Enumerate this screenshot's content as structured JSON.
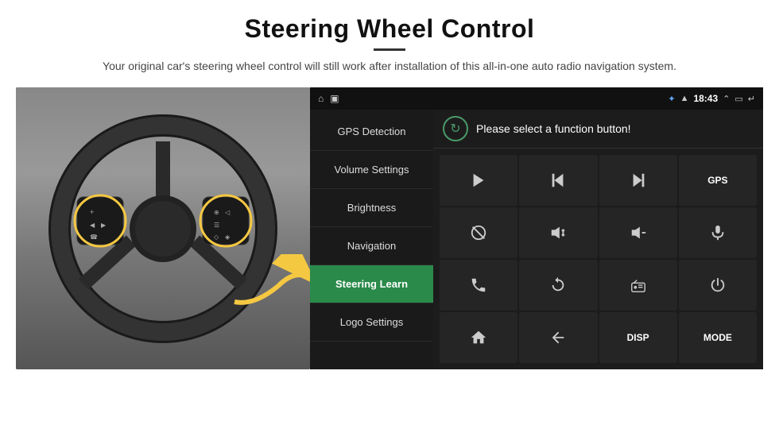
{
  "header": {
    "title": "Steering Wheel Control",
    "subtitle": "Your original car's steering wheel control will still work after installation of this all-in-one auto radio navigation system."
  },
  "status_bar": {
    "time": "18:43",
    "icons": [
      "home",
      "image",
      "bluetooth",
      "signal",
      "chevron-up",
      "battery",
      "back"
    ]
  },
  "menu": {
    "items": [
      {
        "label": "GPS Detection",
        "active": false
      },
      {
        "label": "Volume Settings",
        "active": false
      },
      {
        "label": "Brightness",
        "active": false
      },
      {
        "label": "Navigation",
        "active": false
      },
      {
        "label": "Steering Learn",
        "active": true
      },
      {
        "label": "Logo Settings",
        "active": false
      }
    ]
  },
  "function_panel": {
    "header_text": "Please select a function button!",
    "buttons": [
      {
        "type": "play",
        "label": "▶"
      },
      {
        "type": "prev",
        "label": "⏮"
      },
      {
        "type": "next",
        "label": "⏭"
      },
      {
        "type": "gps",
        "label": "GPS"
      },
      {
        "type": "mute",
        "label": "🚫"
      },
      {
        "type": "vol-up",
        "label": "🔊+"
      },
      {
        "type": "vol-down",
        "label": "🔊-"
      },
      {
        "type": "mic",
        "label": "🎤"
      },
      {
        "type": "phone",
        "label": "📞"
      },
      {
        "type": "rotate",
        "label": "↻"
      },
      {
        "type": "radio",
        "label": "📻"
      },
      {
        "type": "power",
        "label": "⏻"
      },
      {
        "type": "home",
        "label": "🏠"
      },
      {
        "type": "back",
        "label": "↩"
      },
      {
        "type": "disp",
        "label": "DISP"
      },
      {
        "type": "mode",
        "label": "MODE"
      }
    ]
  }
}
